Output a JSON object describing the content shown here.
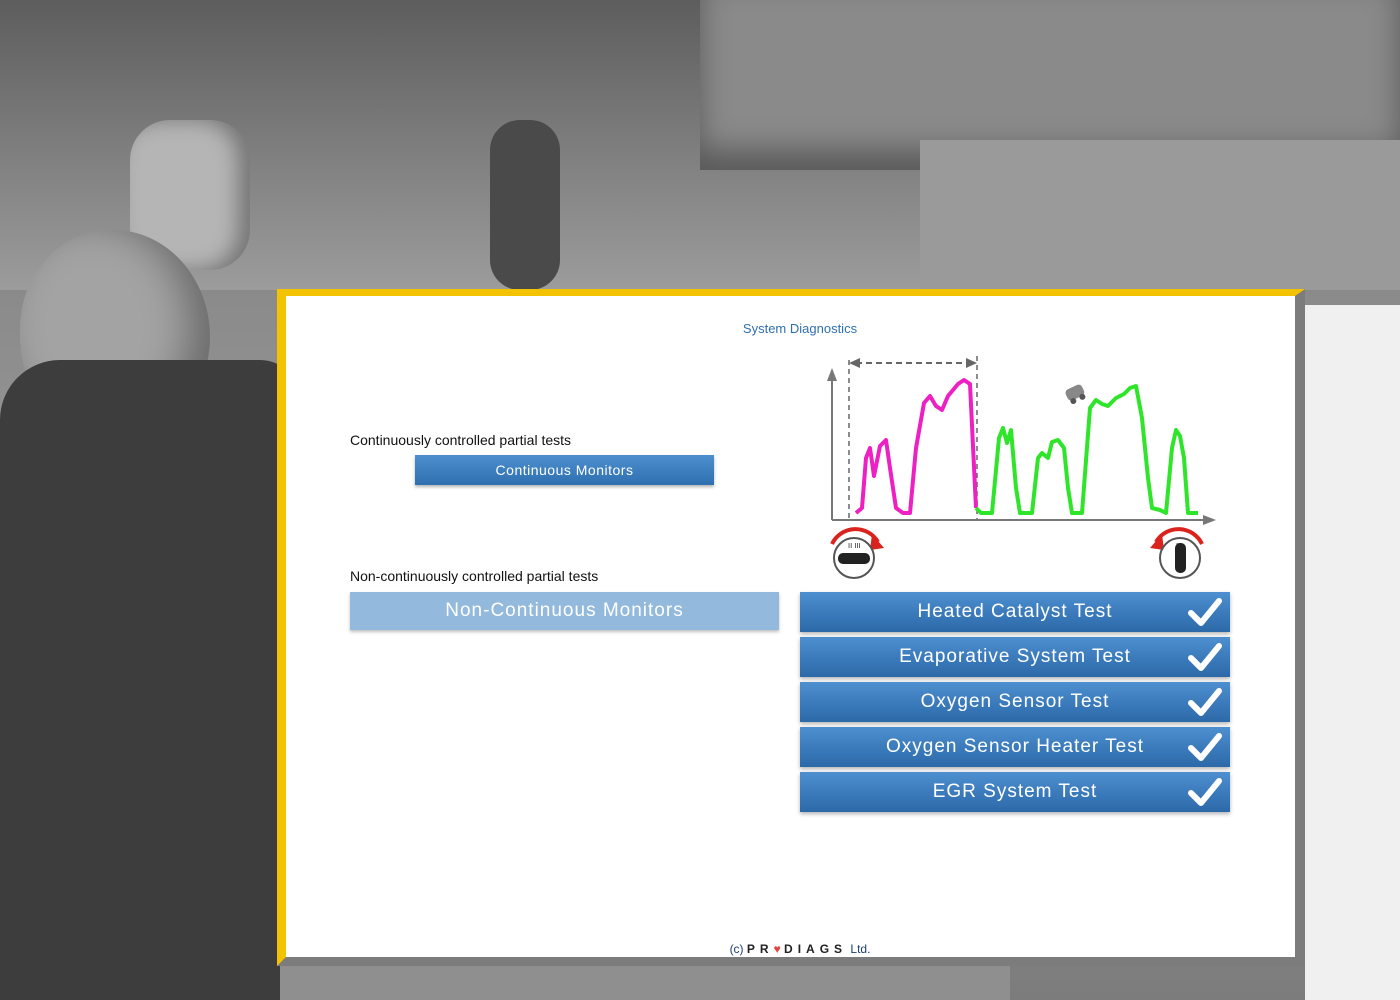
{
  "page": {
    "title": "System Diagnostics"
  },
  "continuous": {
    "label": "Continuously controlled partial tests",
    "button": "Continuous Monitors"
  },
  "non_continuous": {
    "label": "Non-continuously controlled partial tests",
    "button": "Non-Continuous Monitors"
  },
  "tests": [
    {
      "label": "Heated Catalyst Test",
      "checked": true
    },
    {
      "label": "Evaporative System Test",
      "checked": true
    },
    {
      "label": "Oxygen Sensor Test",
      "checked": true
    },
    {
      "label": "Oxygen Sensor Heater Test",
      "checked": true
    },
    {
      "label": "EGR System Test",
      "checked": true
    }
  ],
  "colors": {
    "accent_blue": "#2f6fb0",
    "panel_border_yellow": "#f3c200",
    "signal_magenta": "#ee1fc3",
    "signal_green": "#2fe52a",
    "arrow_red": "#d9231c"
  },
  "footer": {
    "prefix": "(c)",
    "brand_left": "PR",
    "brand_right": "DIAGS",
    "suffix": "Ltd."
  }
}
